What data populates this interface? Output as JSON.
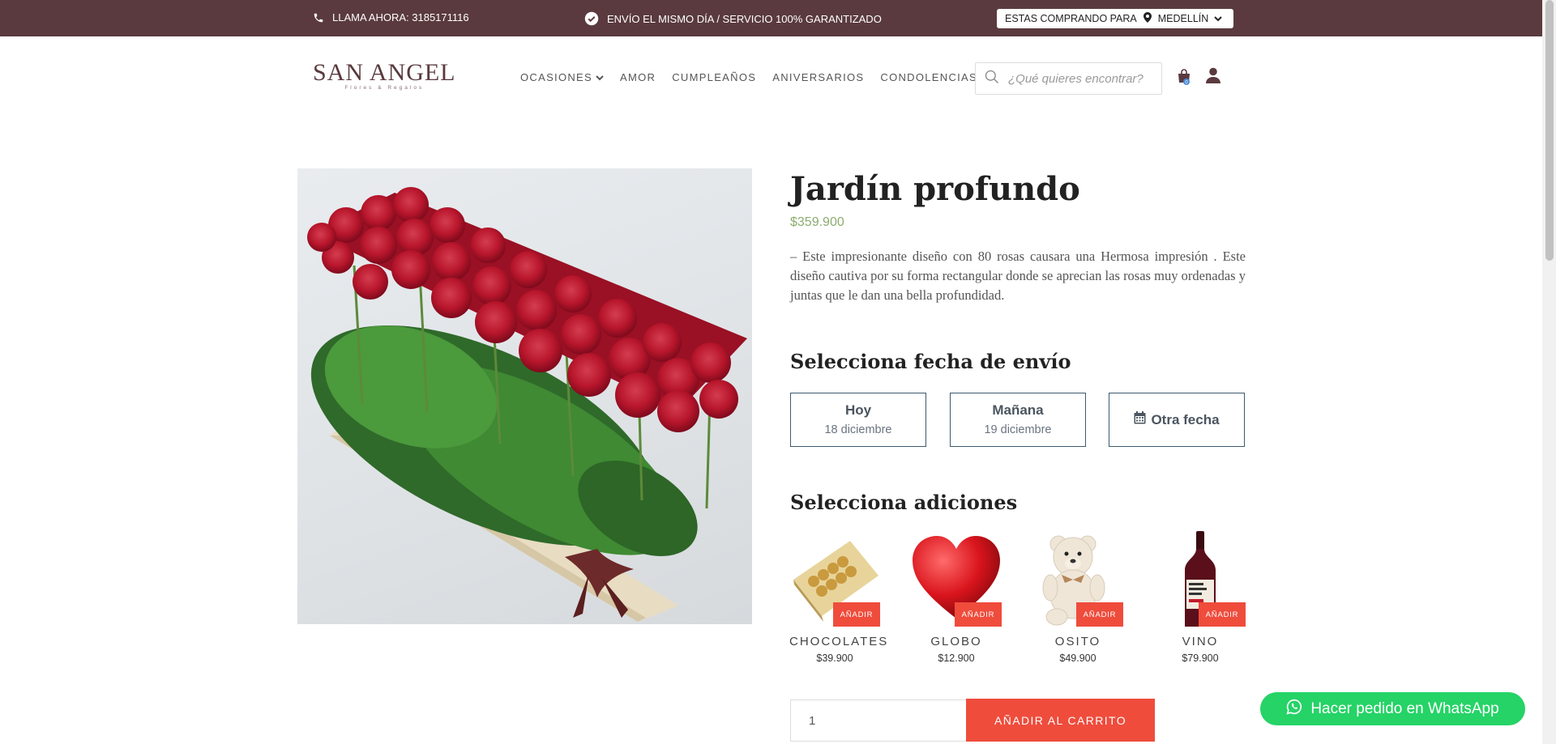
{
  "topbar": {
    "phone_text": "LLAMA AHORA: 3185171116",
    "promise_text": "ENVÍO EL MISMO DÍA / SERVICIO 100% GARANTIZADO",
    "city_prefix": "ESTAS COMPRANDO PARA",
    "city_name": "MEDELLÍN"
  },
  "header": {
    "brand": "SAN ANGEL",
    "tagline": "Flores & Regalos",
    "nav": [
      "OCASIONES",
      "AMOR",
      "CUMPLEAÑOS",
      "ANIVERSARIOS",
      "CONDOLENCIAS"
    ],
    "search_placeholder": "¿Qué quieres encontrar?",
    "cart_count": "0"
  },
  "product": {
    "title": "Jardín profundo",
    "price": "$359.900",
    "description": "– Este impresionante diseño con 80 rosas causara una Hermosa impresión . Este diseño cautiva por su forma rectangular donde se aprecian las rosas muy ordenadas y juntas que le dan una bella profundidad."
  },
  "delivery": {
    "title": "Selecciona fecha de envío",
    "options": [
      {
        "label": "Hoy",
        "sub": "18 diciembre"
      },
      {
        "label": "Mañana",
        "sub": "19 diciembre"
      },
      {
        "label": "Otra fecha",
        "sub": ""
      }
    ]
  },
  "addons": {
    "title": "Selecciona adiciones",
    "button_label": "AÑADIR",
    "items": [
      {
        "name": "CHOCOLATES",
        "price": "$39.900"
      },
      {
        "name": "GLOBO",
        "price": "$12.900"
      },
      {
        "name": "OSITO",
        "price": "$49.900"
      },
      {
        "name": "VINO",
        "price": "$79.900"
      }
    ]
  },
  "cart": {
    "quantity": "1",
    "add_label": "AÑADIR AL CARRITO"
  },
  "whatsapp": {
    "label": "Hacer pedido en WhatsApp"
  },
  "colors": {
    "topbar_bg": "#5a3a3e",
    "accent_red": "#ef4c3c",
    "price_green": "#8bac6f",
    "whatsapp_green": "#25d366"
  }
}
